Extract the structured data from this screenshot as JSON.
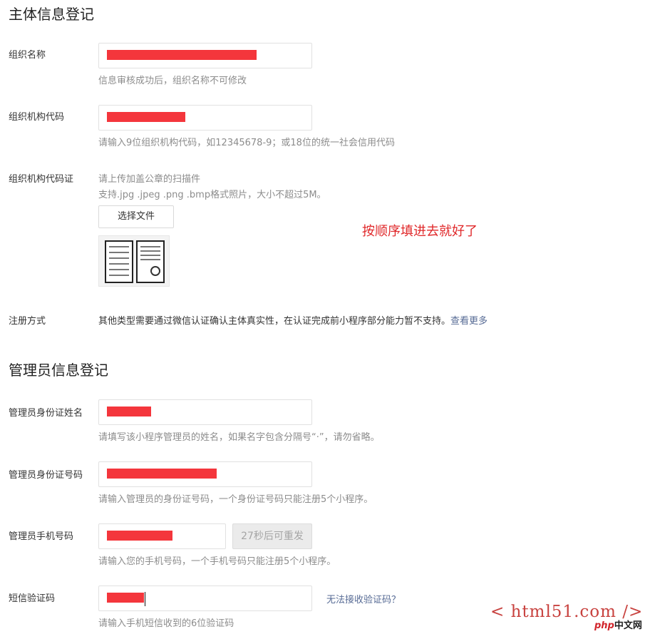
{
  "section1": {
    "title": "主体信息登记",
    "org_name": {
      "label": "组织名称",
      "hint": "信息审核成功后，组织名称不可修改"
    },
    "org_code": {
      "label": "组织机构代码",
      "hint": "请输入9位组织机构代码，如12345678-9；或18位的统一社会信用代码"
    },
    "org_cert": {
      "label": "组织机构代码证",
      "hint1": "请上传加盖公章的扫描件",
      "hint2": "支持.jpg .jpeg .png .bmp格式照片，大小不超过5M。",
      "button": "选择文件"
    },
    "register_method": {
      "label": "注册方式",
      "text": "其他类型需要通过微信认证确认主体真实性，在认证完成前小程序部分能力暂不支持。",
      "link": "查看更多"
    }
  },
  "annotation": "按顺序填进去就好了",
  "section2": {
    "title": "管理员信息登记",
    "admin_name": {
      "label": "管理员身份证姓名",
      "hint": "请填写该小程序管理员的姓名，如果名字包含分隔号“·”，请勿省略。"
    },
    "admin_id": {
      "label": "管理员身份证号码",
      "hint": "请输入管理员的身份证号码，一个身份证号码只能注册5个小程序。"
    },
    "admin_phone": {
      "label": "管理员手机号码",
      "hint": "请输入您的手机号码，一个手机号码只能注册5个小程序。",
      "resend_button": "27秒后可重发"
    },
    "sms_code": {
      "label": "短信验证码",
      "hint": "请输入手机短信收到的6位验证码",
      "help_link": "无法接收验证码？"
    }
  },
  "watermark": {
    "site": "< html51.com />",
    "logo_php": "php",
    "logo_cn": "中文网"
  },
  "colors": {
    "redaction": "#f4363c",
    "link": "#576b95",
    "annotation": "#e0282a"
  }
}
